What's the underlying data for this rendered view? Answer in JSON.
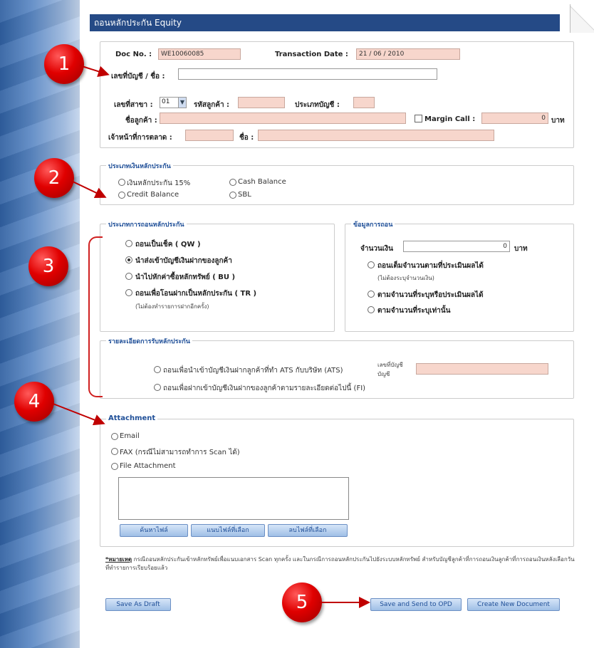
{
  "title": "ถอนหลักประกัน Equity",
  "header": {
    "doc_no_label": "Doc No. :",
    "doc_no_value": "WE10060085",
    "trans_date_label": "Transaction Date :",
    "trans_date_value": "21 / 06 / 2010",
    "account_label": "เลขที่บัญชี / ชื่อ :",
    "branch_label": "เลขที่สาขา :",
    "branch_value": "01",
    "customer_code_label": "รหัสลูกค้า :",
    "account_type_label": "ประเภทบัญชี :",
    "customer_name_label": "ชื่อลูกค้า :",
    "margin_call_label": "Margin Call :",
    "margin_call_value": "0",
    "margin_unit": "บาท",
    "marketing_label": "เจ้าหน้าที่การตลาด :",
    "marketing_name_label": "ชื่อ :"
  },
  "collateral_type": {
    "legend": "ประเภทเงินหลักประกัน",
    "options": [
      "เงินหลักประกัน 15%",
      "Cash Balance",
      "Credit Balance",
      "SBL"
    ]
  },
  "withdraw_type": {
    "legend": "ประเภทการถอนหลักประกัน",
    "options": [
      "ถอนเป็นเช็ค ( QW )",
      "นำส่งเข้าบัญชีเงินฝากของลูกค้า",
      "นำไปหักค่าซื้อหลักทรัพย์ ( BU )",
      "ถอนเพื่อโอนฝากเป็นหลักประกัน ( TR )"
    ],
    "note": "(ไม่ต้องทำรายการฝากอีกครั้ง)"
  },
  "withdraw_info": {
    "legend": "ข้อมูลการถอน",
    "amount_label": "จำนวนเงิน",
    "amount_value": "0",
    "amount_unit": "บาท",
    "options": [
      "ถอนเต็มจำนวนตามที่ประเมินผลได้",
      "ตามจำนวนที่ระบุหรือประเมินผลได้",
      "ตามจำนวนที่ระบุเท่านั้น"
    ],
    "option_note": "(ไม่ต้องระบุจำนวนเงิน)"
  },
  "transfer_detail": {
    "legend": "รายละเอียดการรับหลักประกัน",
    "options": [
      "ถอนเพื่อนำเข้าบัญชีเงินฝากลูกค้าที่ทำ ATS กับบริษัท (ATS)",
      "ถอนเพื่อฝากเข้าบัญชีเงินฝากของลูกค้าตามรายละเอียดต่อไปนี้ (FI)"
    ],
    "account_label": "เลขที่บัญชี บัญชี"
  },
  "attachment": {
    "legend": "Attachment",
    "options": [
      "Email",
      "FAX (กรณีไม่สามารถทำการ Scan ได้)",
      "File Attachment"
    ],
    "buttons": [
      "ค้นหาไฟล์",
      "แนบไฟล์ที่เลือก",
      "ลบไฟล์ที่เลือก"
    ]
  },
  "footnote": {
    "label": "*หมายเหตุ",
    "text": " กรณีถอนหลักประกันเข้าหลักทรัพย์เพื่อแนบเอกสาร Scan ทุกครั้ง และในกรณีการถอนหลักประกันไปยังระบบหลักทรัพย์ สำหรับบัญชีลูกค้าที่การถอนเงินลูกค้าที่การถอนเงินหลังเลือกวันที่ทำรายการเรียบร้อยแล้ว"
  },
  "actions": {
    "save_draft": "Save As Draft",
    "save_send": "Save and Send to OPD",
    "create_new": "Create New Document"
  },
  "markers": [
    "1",
    "2",
    "3",
    "4",
    "5"
  ]
}
